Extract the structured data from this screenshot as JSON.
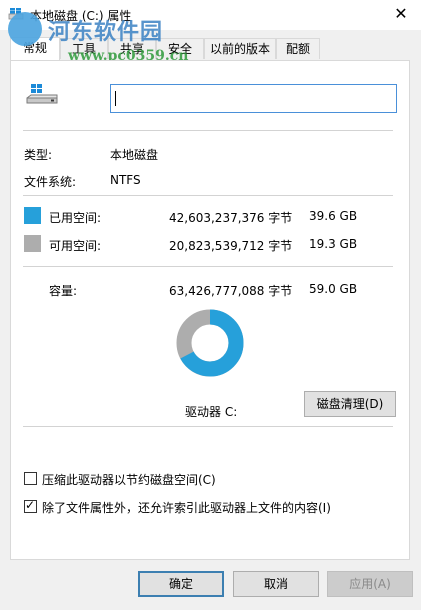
{
  "window": {
    "title": "本地磁盘 (C:) 属性",
    "close_glyph": "✕"
  },
  "watermark": {
    "title": "河东软件园",
    "url": "www.pc0359.cn"
  },
  "tabs": [
    {
      "label": "常规",
      "active": true
    },
    {
      "label": "工具",
      "active": false
    },
    {
      "label": "共享",
      "active": false
    },
    {
      "label": "安全",
      "active": false
    },
    {
      "label": "以前的版本",
      "active": false
    },
    {
      "label": "配额",
      "active": false
    }
  ],
  "general": {
    "drive_icon": "drive-icon",
    "name_value": "",
    "type_label": "类型:",
    "type_value": "本地磁盘",
    "fs_label": "文件系统:",
    "fs_value": "NTFS",
    "used_label": "已用空间:",
    "used_bytes": "42,603,237,376 字节",
    "used_gb": "39.6 GB",
    "free_label": "可用空间:",
    "free_bytes": "20,823,539,712 字节",
    "free_gb": "19.3 GB",
    "capacity_label": "容量:",
    "capacity_bytes": "63,426,777,088 字节",
    "capacity_gb": "59.0 GB",
    "used_fraction": 0.672,
    "used_color": "#26a0da",
    "free_color": "#adadad",
    "drive_label": "驱动器 C:",
    "cleanup_button": "磁盘清理(D)",
    "compress_label": "压缩此驱动器以节约磁盘空间(C)",
    "compress_checked": false,
    "index_label": "除了文件属性外，还允许索引此驱动器上文件的内容(I)",
    "index_checked": true
  },
  "footer": {
    "ok": "确定",
    "cancel": "取消",
    "apply": "应用(A)"
  }
}
